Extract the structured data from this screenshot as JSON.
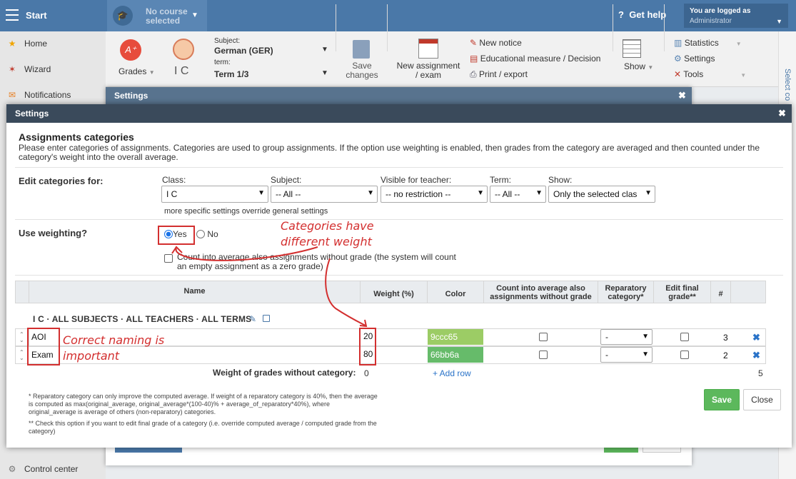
{
  "topbar": {
    "start": "Start",
    "course": "No course selected",
    "help": "Get help",
    "logged_in": "You are logged as",
    "user": "Administrator"
  },
  "sidebar": {
    "items": [
      {
        "label": "Home",
        "icon": "star-icon"
      },
      {
        "label": "Wizard",
        "icon": "wizard-icon"
      },
      {
        "label": "Notifications",
        "icon": "mail-icon"
      },
      {
        "label": "Control center",
        "icon": "gear-icon"
      }
    ]
  },
  "ribbon": {
    "grades": "Grades",
    "subject_label": "Subject:",
    "subject": "German (GER)",
    "class": "I C",
    "term_label": "term:",
    "term": "Term 1/3",
    "save": "Save changes",
    "new_assignment": "New assignment / exam",
    "new_notice": "New notice",
    "edu_measure": "Educational measure / Decision",
    "print": "Print / export",
    "show": "Show",
    "statistics": "Statistics",
    "settings": "Settings",
    "tools": "Tools",
    "side_tab": "Select co"
  },
  "back_dialog": {
    "title": "Settings"
  },
  "dialog": {
    "title": "Settings",
    "header": "Assignments categories",
    "description": "Please enter categories of assignments. Categories are used to group assignments. If the option use weighting is enabled, then grades from the category are averaged and then counted under the category's weight into the overall average.",
    "edit_for": "Edit categories for:",
    "filters": {
      "class": {
        "label": "Class:",
        "value": "I C"
      },
      "subject": {
        "label": "Subject:",
        "value": "-- All --"
      },
      "teacher": {
        "label": "Visible for teacher:",
        "value": "-- no restriction --"
      },
      "term": {
        "label": "Term:",
        "value": "-- All --"
      },
      "show": {
        "label": "Show:",
        "value": "Only the selected clas"
      }
    },
    "override_note": "more specific settings override general settings",
    "use_weighting": "Use weighting?",
    "yes": "Yes",
    "no": "No",
    "weighting_selected": "yes",
    "count_empty": "Count into average also assignments without grade (the system will count an empty assignment as a zero grade)",
    "columns": {
      "name": "Name",
      "weight": "Weight (%)",
      "color": "Color",
      "count": "Count into average also assignments without grade",
      "reparatory": "Reparatory category*",
      "edit_final": "Edit final grade**",
      "num": "#"
    },
    "group": "I C · ALL SUBJECTS · ALL TEACHERS · ALL TERMS",
    "rows": [
      {
        "name": "AOI",
        "weight": "20",
        "color": "9ccc65",
        "color_hex": "#9ccc65",
        "count": false,
        "reparatory": "-",
        "edit_final": false,
        "num": "3"
      },
      {
        "name": "Exam",
        "weight": "80",
        "color": "66bb6a",
        "color_hex": "#66bb6a",
        "count": false,
        "reparatory": "-",
        "edit_final": false,
        "num": "2"
      }
    ],
    "no_cat_label": "Weight of grades without category:",
    "no_cat_value": "0",
    "add_row": "+ Add row",
    "total": "5",
    "note1": "* Reparatory category can only improve the computed average. If weight of a reparatory category is 40%, then the average is computed as max(original_average, original_average*(100-40)% + average_of_reparatory*40%), where original_average is average of others (non-reparatory) categories.",
    "note2": "** Check this option if you want to edit final grade of a category (i.e. override computed average / computed grade from the category)",
    "save": "Save",
    "close": "Close"
  },
  "annotations": {
    "weight": "Categories have different weight",
    "naming": "Correct naming is important"
  },
  "colors": {
    "topbar": "#4a78a8",
    "annotation": "#d32f2f",
    "save": "#5cb85c"
  }
}
